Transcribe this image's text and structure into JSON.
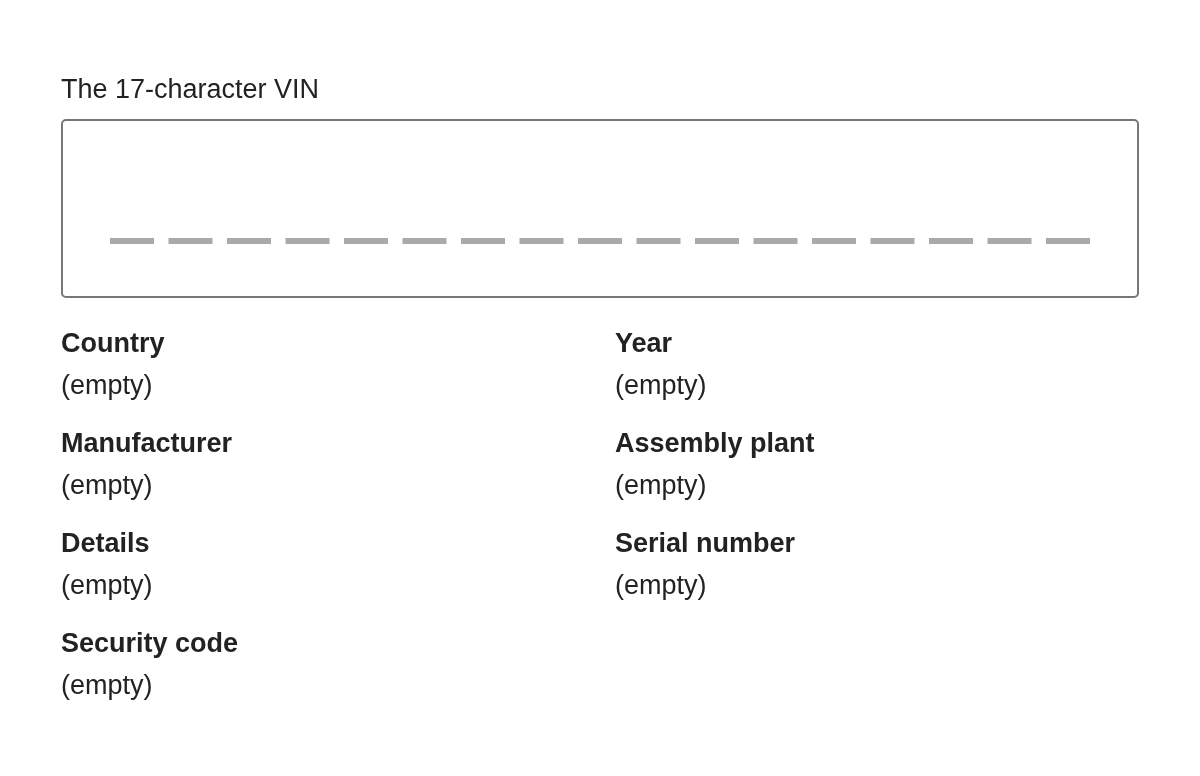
{
  "vin_field": {
    "label": "The 17-character VIN"
  },
  "decoded_fields": [
    {
      "label": "Country",
      "value": "(empty)"
    },
    {
      "label": "Year",
      "value": "(empty)"
    },
    {
      "label": "Manufacturer",
      "value": "(empty)"
    },
    {
      "label": "Assembly plant",
      "value": "(empty)"
    },
    {
      "label": "Details",
      "value": "(empty)"
    },
    {
      "label": "Serial number",
      "value": "(empty)"
    },
    {
      "label": "Security code",
      "value": "(empty)"
    }
  ]
}
